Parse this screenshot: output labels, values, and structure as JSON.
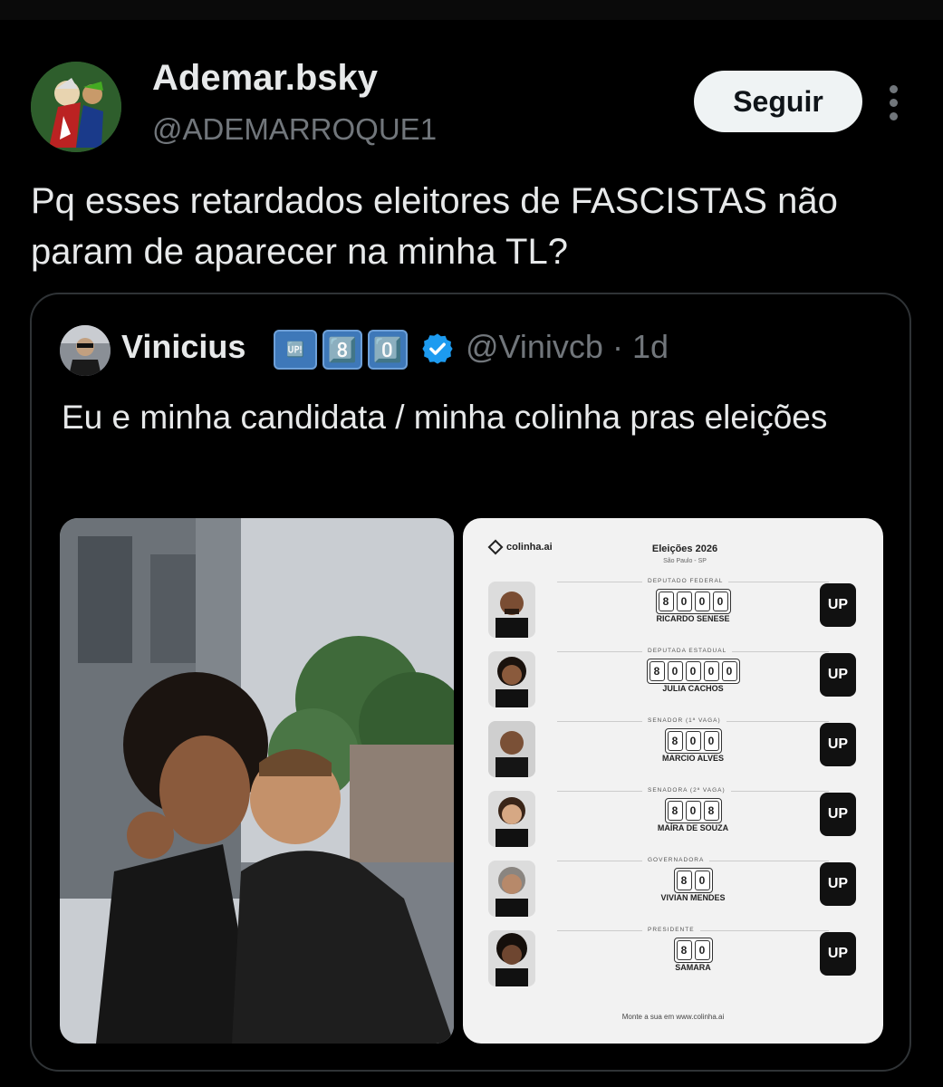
{
  "post": {
    "display_name": "Ademar.bsky",
    "handle": "@ADEMARROQUE1",
    "follow_label": "Seguir",
    "text": "Pq esses retardados eleitores de FASCISTAS não param de aparecer na minha TL?"
  },
  "quote": {
    "display_name": "Vinicius",
    "badges": [
      "🆙",
      "8️⃣",
      "0️⃣"
    ],
    "handle_time": "@Vinivcb · 1d",
    "text": "Eu e minha candidata / minha colinha pras eleições",
    "slate": {
      "logo": "colinha.ai",
      "title": "Eleições 2026",
      "subtitle": "São Paulo - SP",
      "candidates": [
        {
          "office": "DEPUTADO FEDERAL",
          "number": [
            "8",
            "0",
            "0",
            "0"
          ],
          "name": "RICARDO SENESE",
          "party": "UP"
        },
        {
          "office": "DEPUTADA ESTADUAL",
          "number": [
            "8",
            "0",
            "0",
            "0",
            "0"
          ],
          "name": "JULIA CACHOS",
          "party": "UP"
        },
        {
          "office": "SENADOR (1ª VAGA)",
          "number": [
            "8",
            "0",
            "0"
          ],
          "name": "MARCIO ALVES",
          "party": "UP"
        },
        {
          "office": "SENADORA (2ª VAGA)",
          "number": [
            "8",
            "0",
            "8"
          ],
          "name": "MAÍRA DE SOUZA",
          "party": "UP"
        },
        {
          "office": "GOVERNADORA",
          "number": [
            "8",
            "0"
          ],
          "name": "VIVIAN MENDES",
          "party": "UP"
        },
        {
          "office": "PRESIDENTE",
          "number": [
            "8",
            "0"
          ],
          "name": "SAMARA",
          "party": "UP"
        }
      ],
      "footer": "Monte a sua em www.colinha.ai"
    }
  },
  "colors": {
    "background": "#000000",
    "text": "#e7e9ea",
    "muted": "#71767b",
    "verified": "#1d9bf0",
    "border": "#2f3336"
  }
}
